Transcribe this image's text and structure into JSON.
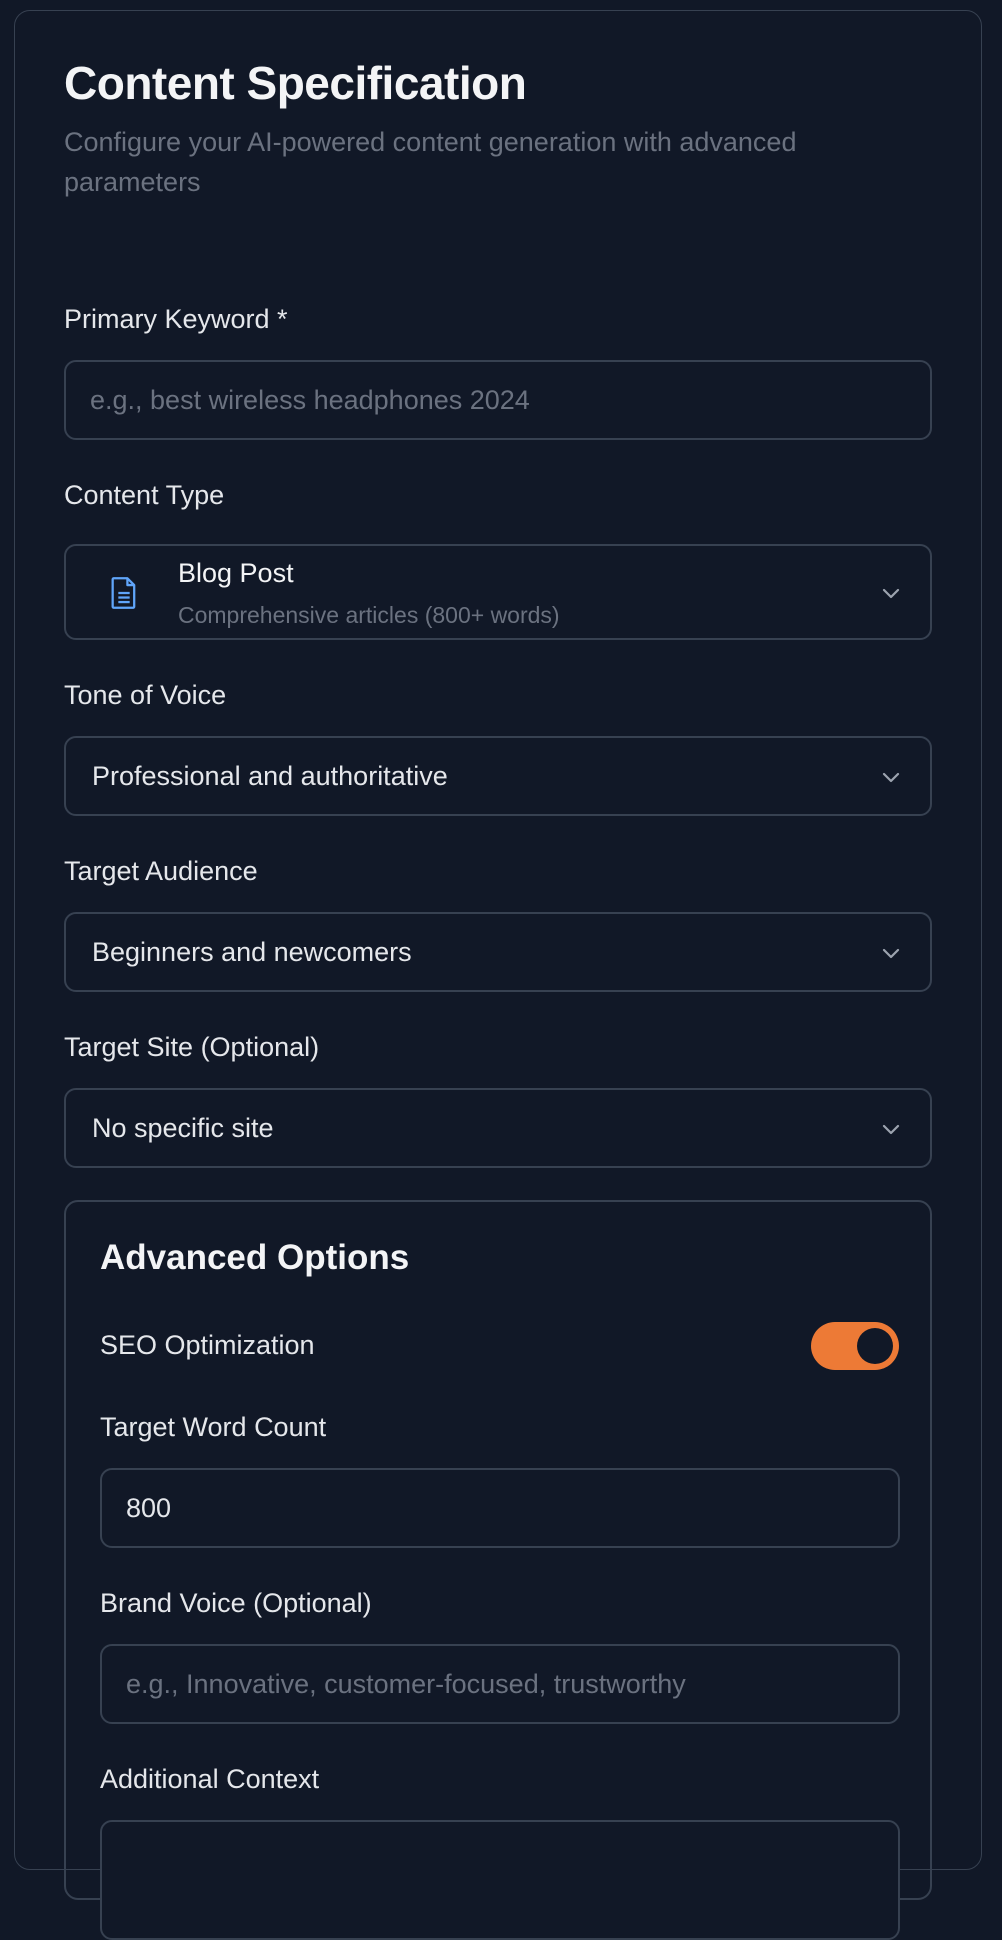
{
  "header": {
    "title": "Content Specification",
    "subtitle": "Configure your AI-powered content generation with advanced parameters"
  },
  "primary_keyword": {
    "label": "Primary Keyword *",
    "placeholder": "e.g., best wireless headphones 2024",
    "value": ""
  },
  "content_type": {
    "label": "Content Type",
    "icon": "document-icon",
    "selected_title": "Blog Post",
    "selected_description": "Comprehensive articles (800+ words)"
  },
  "tone": {
    "label": "Tone of Voice",
    "selected": "Professional and authoritative"
  },
  "audience": {
    "label": "Target Audience",
    "selected": "Beginners and newcomers"
  },
  "target_site": {
    "label": "Target Site (Optional)",
    "selected": "No specific site"
  },
  "advanced": {
    "title": "Advanced Options",
    "seo": {
      "label": "SEO Optimization",
      "enabled": true
    },
    "word_count": {
      "label": "Target Word Count",
      "value": "800"
    },
    "brand_voice": {
      "label": "Brand Voice (Optional)",
      "placeholder": "e.g., Innovative, customer-focused, trustworthy",
      "value": ""
    },
    "additional_context": {
      "label": "Additional Context"
    }
  },
  "colors": {
    "background": "#111827",
    "border": "#374151",
    "accent": "#ed7a36",
    "icon_blue": "#60a5fa",
    "muted_text": "#6b7280"
  }
}
